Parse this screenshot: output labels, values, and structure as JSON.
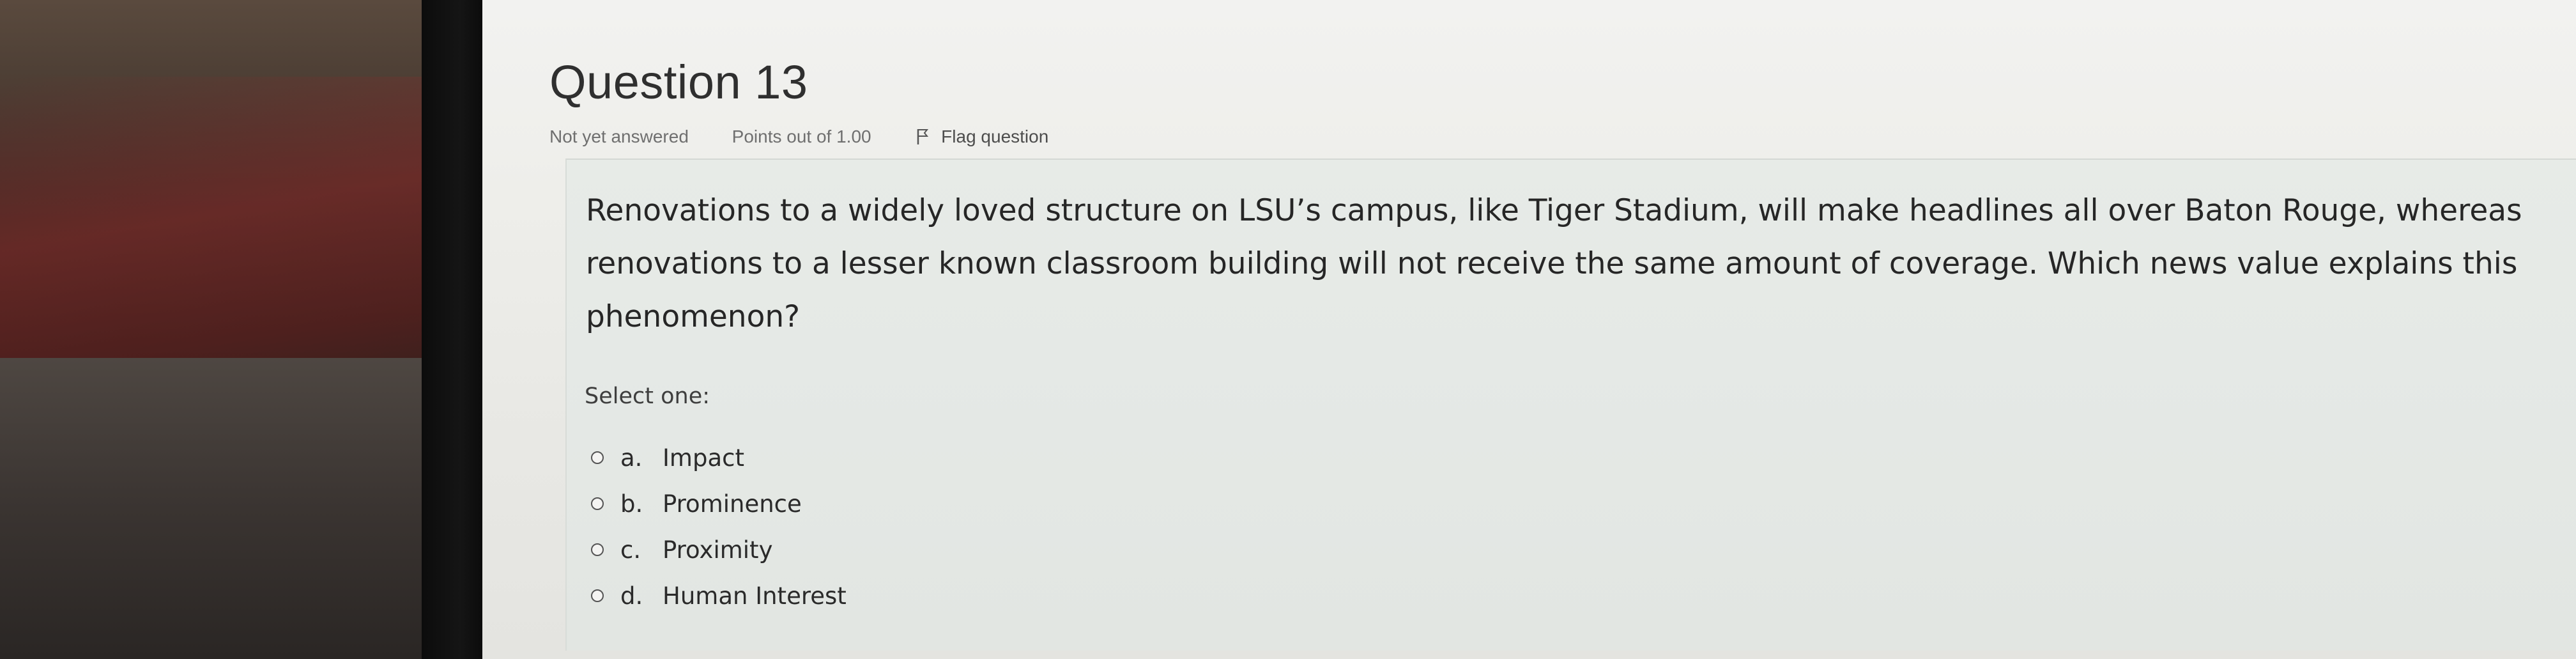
{
  "question": {
    "title": "Question 13",
    "status": "Not yet answered",
    "points": "Points out of 1.00",
    "flag_label": "Flag question",
    "text": "Renovations to a widely loved structure on LSU’s campus, like Tiger Stadium, will make headlines all over Baton Rouge, whereas renovations to a lesser known classroom building will not receive the same amount of coverage. Which news value explains this phenomenon?",
    "prompt": "Select one:",
    "options": [
      {
        "letter": "a.",
        "label": "Impact"
      },
      {
        "letter": "b.",
        "label": "Prominence"
      },
      {
        "letter": "c.",
        "label": "Proximity"
      },
      {
        "letter": "d.",
        "label": "Human Interest"
      }
    ]
  }
}
